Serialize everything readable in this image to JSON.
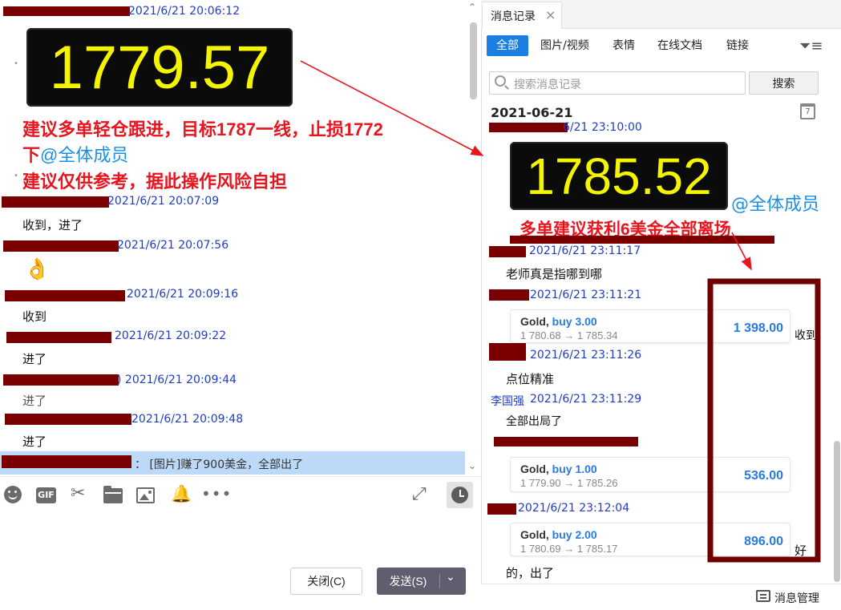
{
  "left": {
    "messages": [
      {
        "time": "2021/6/21 20:06:12"
      },
      {
        "time": "2021/6/21 20:07:09",
        "text": "收到，进了"
      },
      {
        "time": "2021/6/21 20:07:56",
        "emoji": "👌"
      },
      {
        "time": "2021/6/21 20:09:16",
        "text": "收到"
      },
      {
        "time": "2021/6/21 20:09:22",
        "text": "进了"
      },
      {
        "time": ") 2021/6/21 20:09:44",
        "text": "进了"
      },
      {
        "time": "2021/6/21 20:09:48",
        "text": "进了"
      }
    ],
    "price_display": "1779.57",
    "advice_line1": "建议多单轻仓跟进，目标1787一线，止损1772",
    "advice_line2_prefix": "下",
    "advice_mention": "@全体成员",
    "advice_line3": "建议仅供参考，据此操作风险自担",
    "selected_preview": "：  [图片]赚了900美金，全部出了",
    "toolbar_icons": [
      "emoji-icon",
      "gif-icon",
      "scissors-icon",
      "folder-icon",
      "image-icon",
      "bell-icon",
      "more-icon"
    ],
    "gif_label": "GIF",
    "close_button": "关闭(C)",
    "send_button": "发送(S)"
  },
  "right": {
    "tab_title": "消息记录",
    "filter_tabs": [
      "全部",
      "图片/视频",
      "表情",
      "在线文档",
      "链接"
    ],
    "search_placeholder": "搜索消息记录",
    "search_button": "搜索",
    "date_header": "2021-06-21",
    "calendar_day": "7",
    "first_time": "6/21 23:10:00",
    "price_display": "1785.52",
    "mention": "@全体成员",
    "headline": "多单建议获利6美金全部离场",
    "messages": [
      {
        "time": "2021/6/21 23:11:17",
        "text": "老师真是指哪到哪"
      },
      {
        "time": "2021/6/21 23:11:21"
      },
      {
        "time": "2021/6/21 23:11:26",
        "text": "点位精准"
      },
      {
        "sender": "李国强",
        "time": "2021/6/21 23:11:29",
        "text": "全部出局了"
      },
      {
        "time": "2021/6/21 23:12:04",
        "text": "的，出了"
      }
    ],
    "trades": [
      {
        "name": "Gold,",
        "side": "buy 3.00",
        "prices": "1 780.68 → 1 785.34",
        "profit": "1 398.00",
        "reply": "收到"
      },
      {
        "name": "Gold,",
        "side": "buy 1.00",
        "prices": "1 779.90 → 1 785.26",
        "profit": "536.00"
      },
      {
        "name": "Gold,",
        "side": "buy 2.00",
        "prices": "1 780.69 → 1 785.17",
        "profit": "896.00",
        "reply": "好"
      }
    ],
    "manage_label": "消息管理"
  },
  "colors": {
    "red_text": "#e8141e",
    "meta_blue": "#1f3cc4",
    "mention_blue": "#1a8fe6",
    "active_tab": "#1a7fe0",
    "redaction": "#7a0000"
  }
}
